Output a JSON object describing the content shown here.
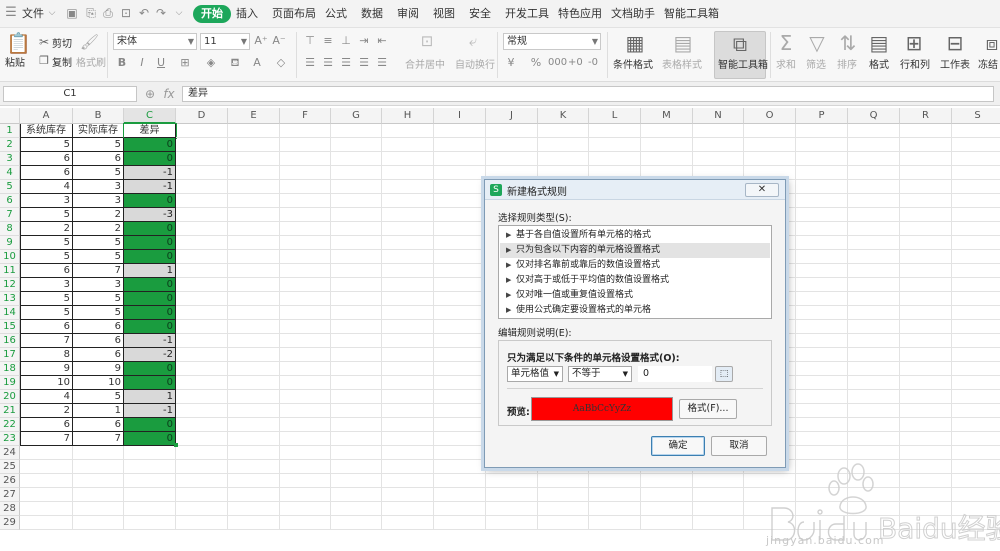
{
  "menubar": {
    "file": "文件",
    "tabs": [
      "开始",
      "插入",
      "页面布局",
      "公式",
      "数据",
      "审阅",
      "视图",
      "安全",
      "开发工具",
      "特色应用",
      "文档助手",
      "智能工具箱"
    ]
  },
  "ribbon": {
    "paste": "粘贴",
    "cut": "剪切",
    "copy": "复制",
    "format_painter": "格式刷",
    "font_name": "宋体",
    "font_size": "11",
    "merge_center": "合并居中",
    "wrap_text": "自动换行",
    "number_format": "常规",
    "conditional_format": "条件格式",
    "table_style": "表格样式",
    "smart_toolbox": "智能工具箱",
    "sum": "求和",
    "filter": "筛选",
    "sort": "排序",
    "format": "格式",
    "rows_cols": "行和列",
    "worksheet": "工作表",
    "freeze": "冻结"
  },
  "formula_bar": {
    "name_box": "C1",
    "fx": "fx",
    "content": "差异"
  },
  "grid": {
    "columns": [
      "A",
      "B",
      "C",
      "D",
      "E",
      "F",
      "G",
      "H",
      "I",
      "J",
      "K",
      "L",
      "M",
      "N",
      "O",
      "P",
      "Q",
      "R",
      "S"
    ],
    "headers": [
      "系统库存",
      "实际库存",
      "差异"
    ],
    "rows": [
      [
        5,
        5,
        0
      ],
      [
        6,
        6,
        0
      ],
      [
        6,
        5,
        -1
      ],
      [
        4,
        3,
        -1
      ],
      [
        3,
        3,
        0
      ],
      [
        5,
        2,
        -3
      ],
      [
        2,
        2,
        0
      ],
      [
        5,
        5,
        0
      ],
      [
        5,
        5,
        0
      ],
      [
        6,
        7,
        1
      ],
      [
        3,
        3,
        0
      ],
      [
        5,
        5,
        0
      ],
      [
        5,
        5,
        0
      ],
      [
        6,
        6,
        0
      ],
      [
        7,
        6,
        -1
      ],
      [
        8,
        6,
        -2
      ],
      [
        9,
        9,
        0
      ],
      [
        10,
        10,
        0
      ],
      [
        4,
        5,
        1
      ],
      [
        2,
        1,
        -1
      ],
      [
        6,
        6,
        0
      ],
      [
        7,
        7,
        0
      ]
    ],
    "row_count": 29
  },
  "dialog": {
    "title": "新建格式规则",
    "close": "取消",
    "select_type_label": "选择规则类型(S):",
    "rule_types": [
      "基于各自值设置所有单元格的格式",
      "只为包含以下内容的单元格设置格式",
      "仅对排名靠前或靠后的数值设置格式",
      "仅对高于或低于平均值的数值设置格式",
      "仅对唯一值或重复值设置格式",
      "使用公式确定要设置格式的单元格"
    ],
    "selected_index": 1,
    "edit_label": "编辑规则说明(E):",
    "condition_label": "只为满足以下条件的单元格设置格式(O):",
    "cond_field": "单元格值",
    "cond_op": "不等于",
    "cond_value": "0",
    "preview_label": "预览:",
    "preview_text": "AaBbCcYyZz",
    "format_btn": "格式(F)...",
    "ok": "确定",
    "cancel": "取消",
    "preview_color": "#ff0000"
  },
  "watermark": {
    "brand": "Baidu经验",
    "url": "jingyan.baidu.com"
  },
  "colors": {
    "accent": "#1da75b",
    "diff_zero": "#1a9c3f",
    "diff_nonzero": "#d9d9d9"
  }
}
